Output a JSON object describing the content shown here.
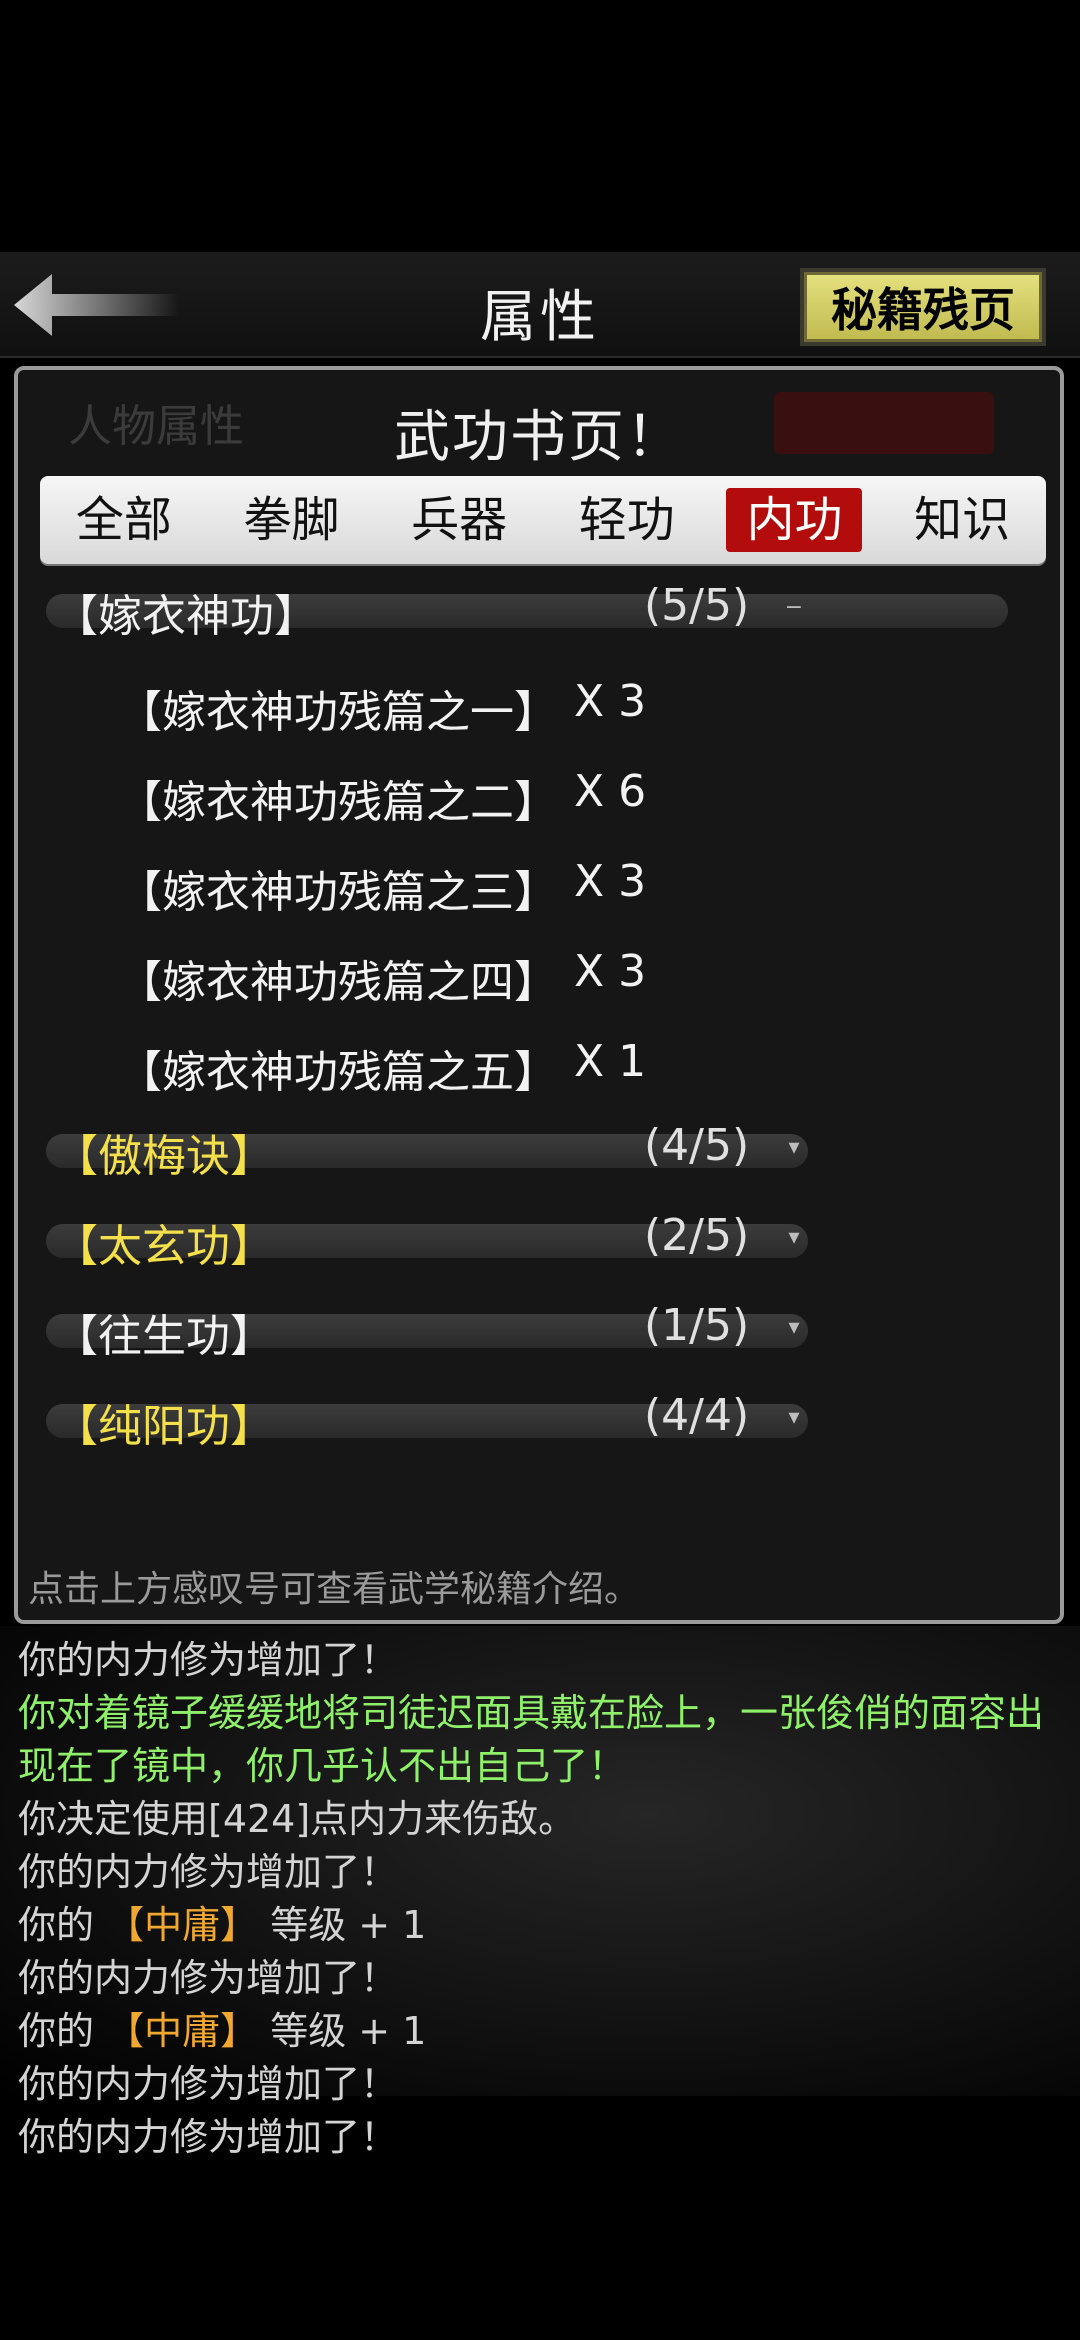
{
  "header": {
    "title": "属性",
    "secret_button": "秘籍残页"
  },
  "modal": {
    "title": "武功书页！",
    "hint": "点击上方感叹号可查看武学秘籍介绍。"
  },
  "tabs": [
    {
      "label": "全部"
    },
    {
      "label": "拳脚"
    },
    {
      "label": "兵器"
    },
    {
      "label": "轻功"
    },
    {
      "label": "内功",
      "active": true
    },
    {
      "label": "知识"
    }
  ],
  "groups": [
    {
      "name": "【嫁衣神功】",
      "count": "(5/5)",
      "toggle": "−",
      "color": "#f2f2f2",
      "items": [
        {
          "name": "【嫁衣神功残篇之一】",
          "qty": "X 3"
        },
        {
          "name": "【嫁衣神功残篇之二】",
          "qty": "X 6"
        },
        {
          "name": "【嫁衣神功残篇之三】",
          "qty": "X 3"
        },
        {
          "name": "【嫁衣神功残篇之四】",
          "qty": "X 3"
        },
        {
          "name": "【嫁衣神功残篇之五】",
          "qty": "X 1"
        }
      ]
    },
    {
      "name": "【傲梅诀】",
      "count": "(4/5)",
      "toggle": "▾",
      "color": "#f4e04a"
    },
    {
      "name": "【太玄功】",
      "count": "(2/5)",
      "toggle": "▾",
      "color": "#f4e04a"
    },
    {
      "name": "【往生功】",
      "count": "(1/5)",
      "toggle": "▾",
      "color": "#f2f2f2"
    },
    {
      "name": "【纯阳功】",
      "count": "(4/4)",
      "toggle": "▾",
      "color": "#f4e04a"
    }
  ],
  "log": [
    {
      "text": "你的内力修为增加了！"
    },
    {
      "text": "你对着镜子缓缓地将司徒迟面具戴在脸上，一张俊俏的面容出现在了镜中，你几乎认不出自己了！",
      "green": true
    },
    {
      "text": "你决定使用[424]点内力来伤敌。"
    },
    {
      "text": "你的内力修为增加了！"
    },
    {
      "pre": "你的 ",
      "hl": "【中庸】",
      "post": " 等级 + 1"
    },
    {
      "text": "你的内力修为增加了！"
    },
    {
      "pre": "你的 ",
      "hl": "【中庸】",
      "post": " 等级 + 1"
    },
    {
      "text": "你的内力修为增加了！"
    },
    {
      "text": "你的内力修为增加了！"
    }
  ],
  "colors": {
    "active_tab": "#b20c0c",
    "gold_name": "#f4e04a",
    "green_log": "#8ff06a",
    "highlight": "#f0a830"
  }
}
